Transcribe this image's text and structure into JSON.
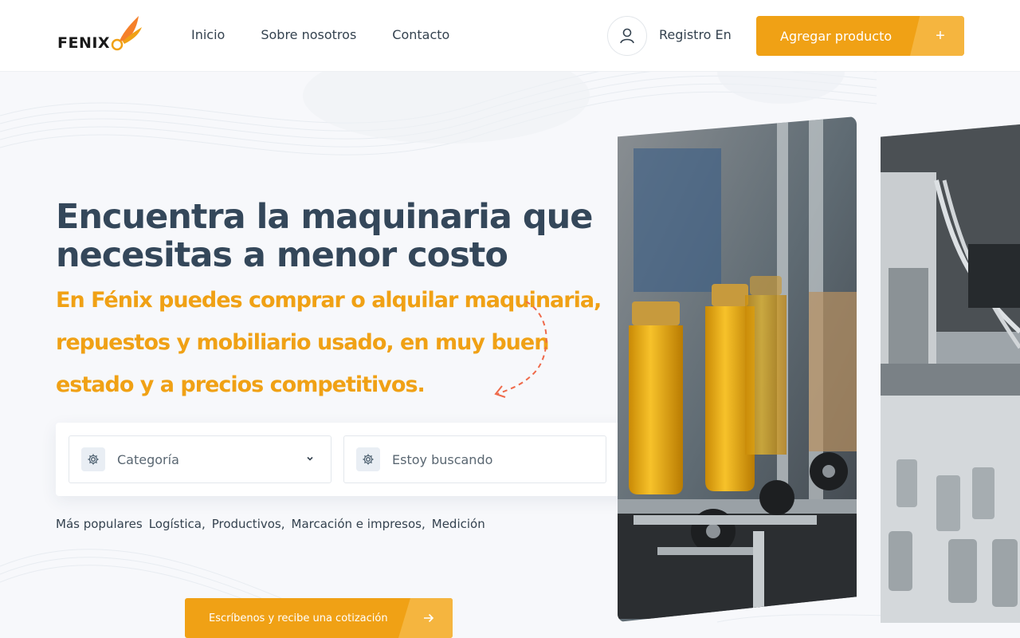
{
  "brand": {
    "logo_text": "FENIX"
  },
  "nav": {
    "items": [
      "Inicio",
      "Sobre nosotros",
      "Contacto"
    ]
  },
  "header": {
    "register_label": "Registro En",
    "add_product_label": "Agregar producto"
  },
  "hero": {
    "title": "Encuentra la maquinaria que necesitas a menor costo",
    "subtitle": "En Fénix puedes comprar o alquilar maquinaria, repuestos y mobiliario usado, en muy buen estado y a precios competitivos."
  },
  "search": {
    "category_label": "Categoría",
    "query_placeholder": "Estoy buscando"
  },
  "popular": {
    "label": "Más populares",
    "tags": [
      "Logística",
      "Productivos",
      "Marcación e impresos",
      "Medición"
    ]
  },
  "cta": {
    "label": "Escríbenos y recibe una cotización"
  },
  "colors": {
    "accent": "#f0a115",
    "accent_light": "#f5b53f",
    "heading": "#34475a"
  },
  "icons": [
    "user-icon",
    "plus-icon",
    "gear-icon",
    "chevron-down-icon",
    "search-icon",
    "arrow-right-icon"
  ]
}
